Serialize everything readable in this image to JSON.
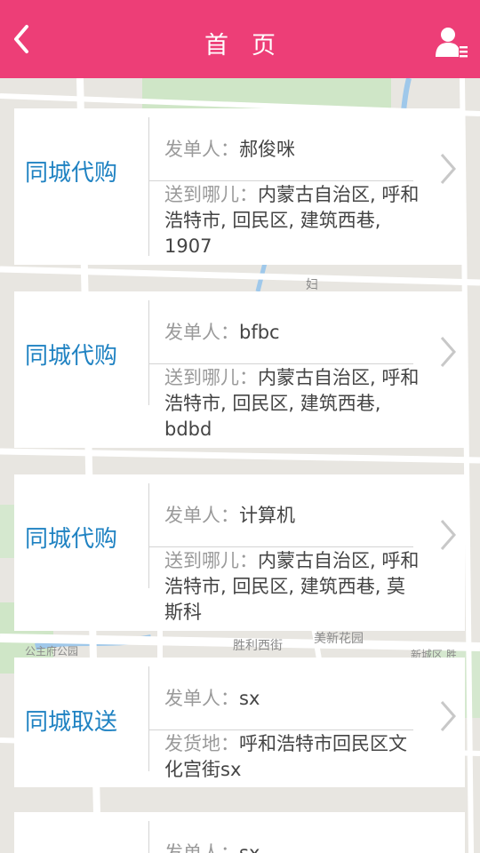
{
  "header": {
    "title": "首页",
    "back_icon": "chevron-left-icon",
    "user_icon": "user-list-icon",
    "background": "#ed3e77"
  },
  "map": {
    "labels": [
      "妇",
      "胜利西街",
      "美新花园",
      "公主府公园",
      "新城区 胜"
    ]
  },
  "orders": [
    {
      "type": "同城代购",
      "sender_label": "发单人：",
      "sender": "郝俊咪",
      "dest_label": "送到哪儿：",
      "dest": "内蒙古自治区, 呼和浩特市, 回民区, 建筑西巷, 1907"
    },
    {
      "type": "同城代购",
      "sender_label": "发单人：",
      "sender": "bfbc",
      "dest_label": "送到哪儿：",
      "dest": "内蒙古自治区, 呼和浩特市, 回民区, 建筑西巷, bdbd"
    },
    {
      "type": "同城代购",
      "sender_label": "发单人：",
      "sender": "计算机",
      "dest_label": "送到哪儿：",
      "dest": "内蒙古自治区, 呼和浩特市, 回民区, 建筑西巷, 莫斯科"
    },
    {
      "type": "同城取送",
      "sender_label": "发单人：",
      "sender": "sx",
      "dest_label": "发货地：",
      "dest": "呼和浩特市回民区文化宫街sx"
    },
    {
      "type": "",
      "sender_label": "发单人：",
      "sender": "sx",
      "dest_label": "",
      "dest": ""
    }
  ],
  "colors": {
    "accent": "#ed3e77",
    "type_text": "#1f82c2"
  }
}
